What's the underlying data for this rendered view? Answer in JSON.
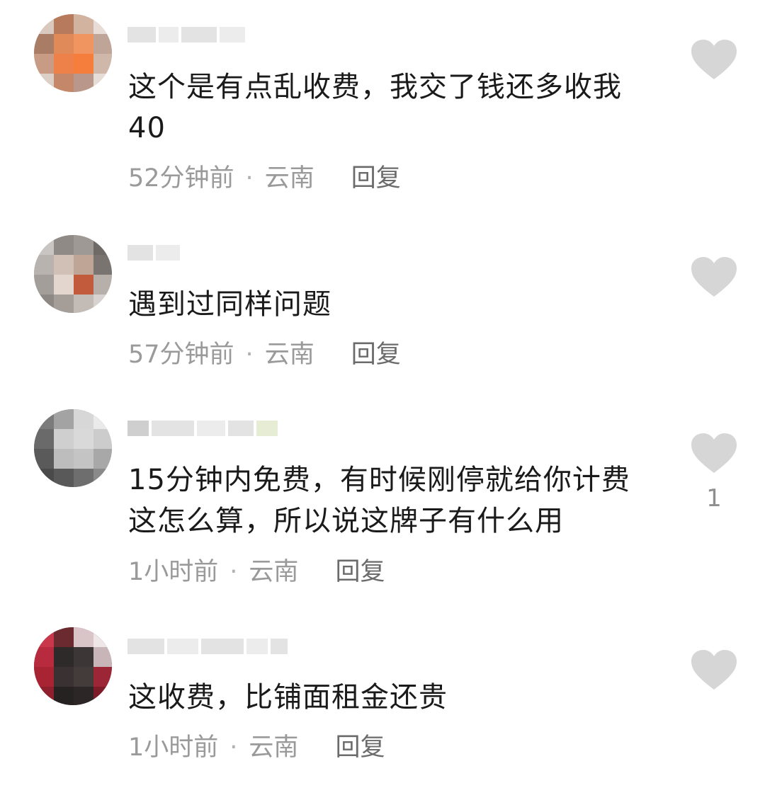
{
  "comments": [
    {
      "text": "这个是有点乱收费，我交了钱还多收我40",
      "time": "52分钟前",
      "location": "云南",
      "reply_label": "回复",
      "like_count": ""
    },
    {
      "text": "遇到过同样问题",
      "time": "57分钟前",
      "location": "云南",
      "reply_label": "回复",
      "like_count": ""
    },
    {
      "text": "15分钟内免费，有时候刚停就给你计费这怎么算，所以说这牌子有什么用",
      "time": "1小时前",
      "location": "云南",
      "reply_label": "回复",
      "like_count": "1"
    },
    {
      "text": "这收费，比铺面租金还贵",
      "time": "1小时前",
      "location": "云南",
      "reply_label": "回复",
      "like_count": ""
    }
  ],
  "separator": "·",
  "icons": {
    "like": "heart-icon"
  },
  "colors": {
    "text": "#1a1a1a",
    "meta": "#9a9a9a",
    "reply": "#6b6b6b",
    "heart": "#d6d6d6"
  }
}
